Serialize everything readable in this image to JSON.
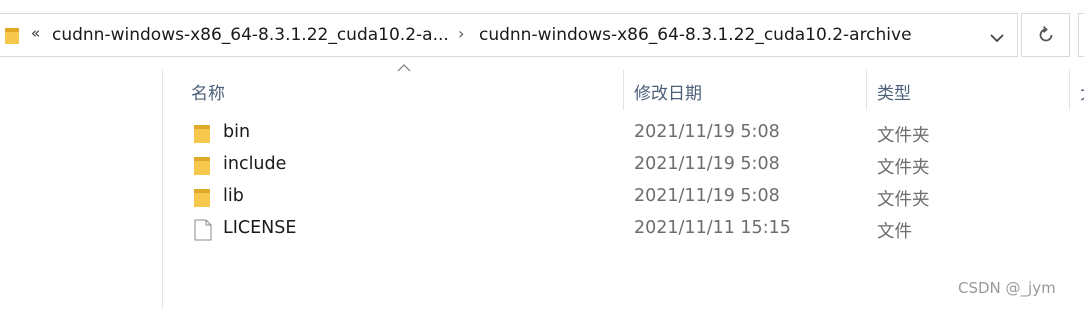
{
  "address_bar": {
    "overflow_glyph": "«",
    "crumb_truncated": "cudnn-windows-x86_64-8.3.1.22_cuda10.2-a...",
    "separator_glyph": "›",
    "crumb_current": "cudnn-windows-x86_64-8.3.1.22_cuda10.2-archive"
  },
  "columns": {
    "name": "名称",
    "date_modified": "修改日期",
    "type": "类型",
    "size_partial": "大"
  },
  "files": [
    {
      "icon": "folder-icon",
      "name": "bin",
      "date": "2021/11/19 5:08",
      "type": "文件夹"
    },
    {
      "icon": "folder-icon",
      "name": "include",
      "date": "2021/11/19 5:08",
      "type": "文件夹"
    },
    {
      "icon": "folder-icon",
      "name": "lib",
      "date": "2021/11/19 5:08",
      "type": "文件夹"
    },
    {
      "icon": "file-icon",
      "name": "LICENSE",
      "date": "2021/11/11 15:15",
      "type": "文件"
    }
  ],
  "watermark": "CSDN @_jym",
  "colors": {
    "folder": "#f6c84e",
    "folder_dark": "#e0a928",
    "header_text": "#4c607a",
    "meta_text": "#6d6d6d",
    "border": "#d9d9d9"
  }
}
